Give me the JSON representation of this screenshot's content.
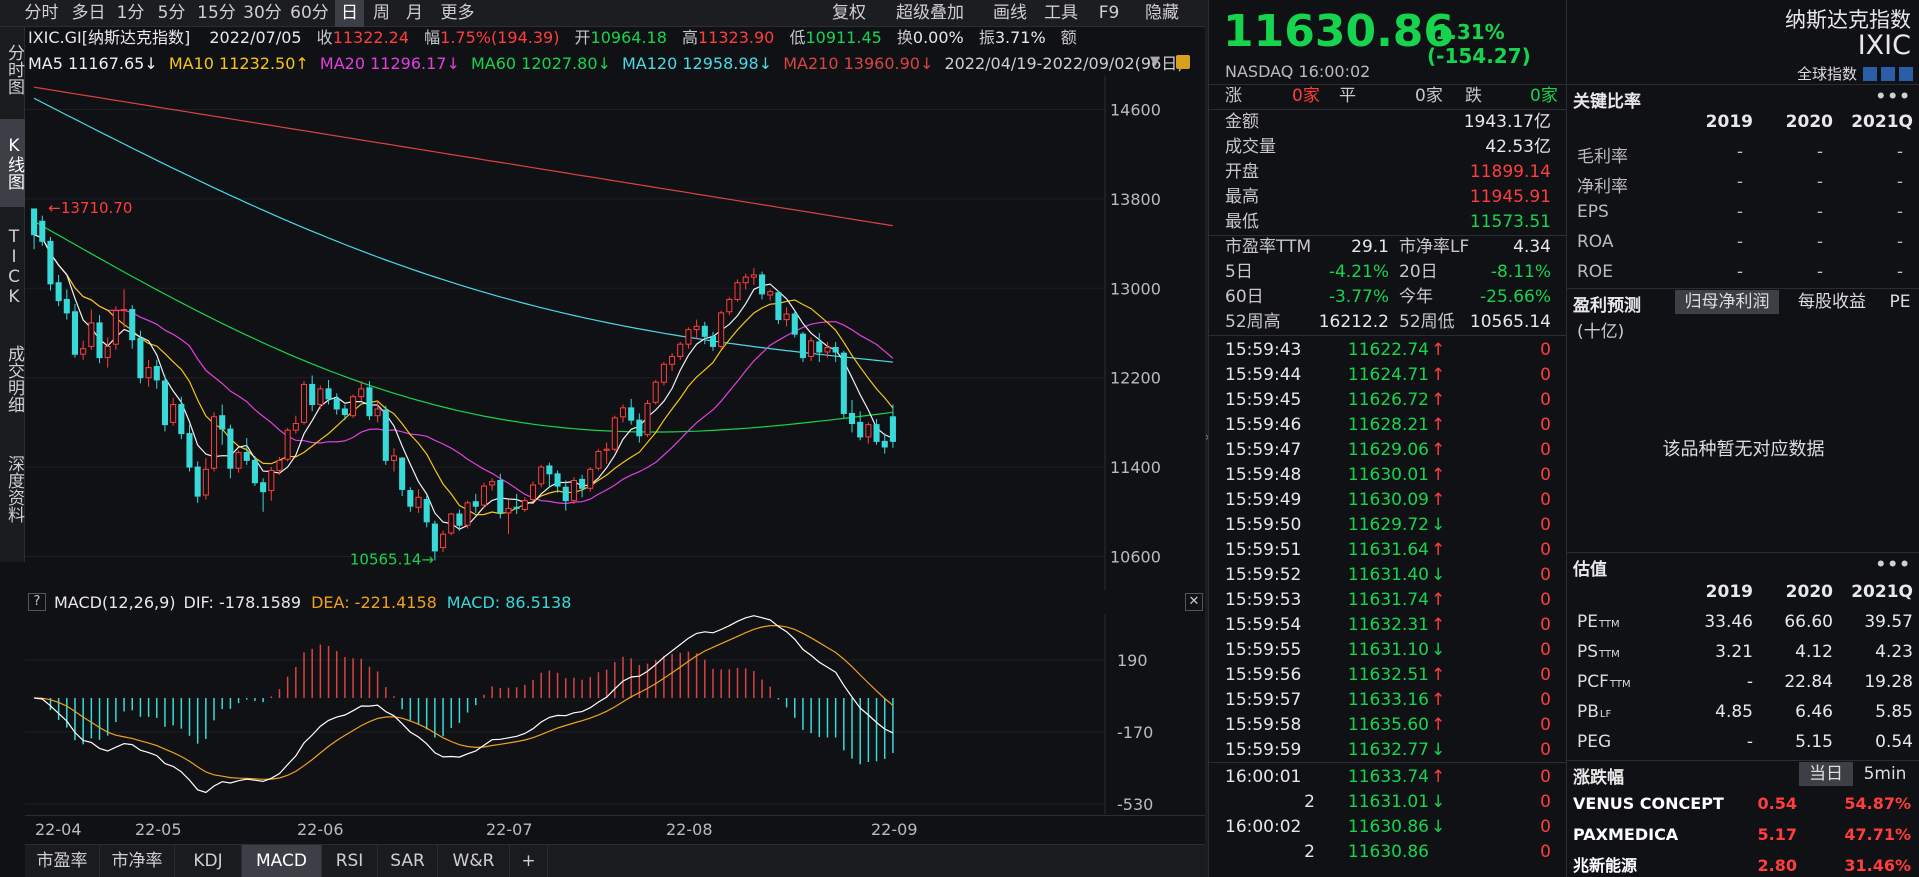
{
  "toolbar": {
    "periods": [
      "分时",
      "多日",
      "1分",
      "5分",
      "15分",
      "30分",
      "60分",
      "日",
      "周",
      "月",
      "更多"
    ],
    "active_period": "日",
    "right_tools": [
      "复权",
      "超级叠加",
      "画线",
      "工具",
      "F9",
      "隐藏"
    ]
  },
  "vertical_tabs": [
    "分时图",
    "K线图",
    "TICK",
    "成交明细",
    "深度资料"
  ],
  "active_vtab": "K线图",
  "info": {
    "code": "IXIC.GI[纳斯达克指数]",
    "date": "2022/07/05",
    "close_label": "收",
    "close": "11322.24",
    "amp_label": "幅",
    "amp": "1.75%(194.39)",
    "open_label": "开",
    "open": "10964.18",
    "high_label": "高",
    "high": "11323.90",
    "low_label": "低",
    "low": "10911.45",
    "turnover_label": "换",
    "turnover": "0.00%",
    "swing_label": "振",
    "swing": "3.71%",
    "amount_label": "额"
  },
  "ma_line": {
    "ma5": "MA5 11167.65↓",
    "ma10": "MA10 11232.50↑",
    "ma20": "MA20 11296.17↓",
    "ma60": "MA60 12027.80↓",
    "ma120": "MA120 12958.98↓",
    "ma210": "MA210 13960.90↓",
    "range": "2022/04/19-2022/09/02(96日)"
  },
  "price_axis": [
    "14600",
    "13800",
    "13000",
    "12200",
    "11400",
    "10600"
  ],
  "annotations": {
    "high_mark": "←13710.70",
    "low_mark": "10565.14→"
  },
  "macd": {
    "title": "MACD(12,26,9)",
    "dif": "DIF: -178.1589",
    "dea": "DEA: -221.4158",
    "macd": "MACD: 86.5138",
    "axis": [
      "190",
      "-170",
      "-530"
    ]
  },
  "date_axis": [
    "22-04",
    "22-05",
    "22-06",
    "22-07",
    "22-08",
    "22-09"
  ],
  "bottom_tabs": [
    "市盈率",
    "市净率",
    "KDJ",
    "MACD",
    "RSI",
    "SAR",
    "W&R",
    "+"
  ],
  "active_bottom_tab": "MACD",
  "colors": {
    "up": "#ff3d3d",
    "down": "#38d9d9",
    "ma5": "#f0f0f0",
    "ma10": "#f5c518",
    "ma20": "#e040e0",
    "ma60": "#17d44f",
    "ma120": "#4ad9e8",
    "ma210": "#d94343",
    "dif": "#ffffff",
    "dea": "#f0a020"
  },
  "chart_data": {
    "type": "candlestick",
    "title": "",
    "xlabel": "",
    "ylabel": "",
    "ylim": [
      10300,
      14900
    ],
    "candles": [
      {
        "o": 13710,
        "h": 13710,
        "c": 13480,
        "l": 13350
      },
      {
        "o": 13600,
        "h": 13650,
        "c": 13420,
        "l": 13380
      },
      {
        "o": 13420,
        "h": 13460,
        "c": 13040,
        "l": 12980
      },
      {
        "o": 13050,
        "h": 13120,
        "c": 12890,
        "l": 12840
      },
      {
        "o": 12900,
        "h": 12990,
        "c": 12780,
        "l": 12720
      },
      {
        "o": 12790,
        "h": 12860,
        "c": 12410,
        "l": 12380
      },
      {
        "o": 12410,
        "h": 12530,
        "c": 12460,
        "l": 12360
      },
      {
        "o": 12480,
        "h": 12810,
        "c": 12690,
        "l": 12450
      },
      {
        "o": 12690,
        "h": 12760,
        "c": 12380,
        "l": 12330
      },
      {
        "o": 12380,
        "h": 12560,
        "c": 12480,
        "l": 12290
      },
      {
        "o": 12500,
        "h": 12840,
        "c": 12800,
        "l": 12450
      },
      {
        "o": 12800,
        "h": 12990,
        "c": 12810,
        "l": 12650
      },
      {
        "o": 12810,
        "h": 12850,
        "c": 12540,
        "l": 12460
      },
      {
        "o": 12550,
        "h": 12620,
        "c": 12200,
        "l": 12150
      },
      {
        "o": 12200,
        "h": 12360,
        "c": 12290,
        "l": 12120
      },
      {
        "o": 12300,
        "h": 12360,
        "c": 12180,
        "l": 12100
      },
      {
        "o": 12170,
        "h": 12220,
        "c": 11780,
        "l": 11720
      },
      {
        "o": 11800,
        "h": 12020,
        "c": 11960,
        "l": 11770
      },
      {
        "o": 11960,
        "h": 12030,
        "c": 11700,
        "l": 11650
      },
      {
        "o": 11700,
        "h": 11780,
        "c": 11400,
        "l": 11360
      },
      {
        "o": 11400,
        "h": 11450,
        "c": 11140,
        "l": 11080
      },
      {
        "o": 11150,
        "h": 11480,
        "c": 11380,
        "l": 11110
      },
      {
        "o": 11390,
        "h": 11890,
        "c": 11850,
        "l": 11360
      },
      {
        "o": 11860,
        "h": 11960,
        "c": 11740,
        "l": 11600
      },
      {
        "o": 11740,
        "h": 11780,
        "c": 11390,
        "l": 11300
      },
      {
        "o": 11390,
        "h": 11550,
        "c": 11530,
        "l": 11350
      },
      {
        "o": 11530,
        "h": 11660,
        "c": 11460,
        "l": 11420
      },
      {
        "o": 11460,
        "h": 11500,
        "c": 11260,
        "l": 11230
      },
      {
        "o": 11260,
        "h": 11300,
        "c": 11180,
        "l": 11000
      },
      {
        "o": 11190,
        "h": 11400,
        "c": 11370,
        "l": 11100
      },
      {
        "o": 11370,
        "h": 11490,
        "c": 11460,
        "l": 11330
      },
      {
        "o": 11470,
        "h": 11750,
        "c": 11730,
        "l": 11450
      },
      {
        "o": 11730,
        "h": 11860,
        "c": 11790,
        "l": 11700
      },
      {
        "o": 11800,
        "h": 12170,
        "c": 12140,
        "l": 11780
      },
      {
        "o": 12140,
        "h": 12220,
        "c": 11960,
        "l": 11900
      },
      {
        "o": 11960,
        "h": 12130,
        "c": 12100,
        "l": 11920
      },
      {
        "o": 12100,
        "h": 12180,
        "c": 12010,
        "l": 11960
      },
      {
        "o": 12010,
        "h": 12060,
        "c": 11920,
        "l": 11870
      },
      {
        "o": 11920,
        "h": 11960,
        "c": 11870,
        "l": 11820
      },
      {
        "o": 11860,
        "h": 12050,
        "c": 12030,
        "l": 11840
      },
      {
        "o": 12030,
        "h": 12170,
        "c": 12100,
        "l": 11990
      },
      {
        "o": 12110,
        "h": 12170,
        "c": 11860,
        "l": 11820
      },
      {
        "o": 11860,
        "h": 11990,
        "c": 11920,
        "l": 11800
      },
      {
        "o": 11910,
        "h": 11950,
        "c": 11460,
        "l": 11420
      },
      {
        "o": 11460,
        "h": 11570,
        "c": 11500,
        "l": 11360
      },
      {
        "o": 11480,
        "h": 11490,
        "c": 11200,
        "l": 11140
      },
      {
        "o": 11190,
        "h": 11220,
        "c": 11050,
        "l": 11000
      },
      {
        "o": 11040,
        "h": 11200,
        "c": 11130,
        "l": 10990
      },
      {
        "o": 11110,
        "h": 11140,
        "c": 10910,
        "l": 10860
      },
      {
        "o": 10890,
        "h": 10920,
        "c": 10650,
        "l": 10565
      },
      {
        "o": 10680,
        "h": 10830,
        "c": 10800,
        "l": 10640
      },
      {
        "o": 10810,
        "h": 10990,
        "c": 10980,
        "l": 10790
      },
      {
        "o": 10980,
        "h": 11020,
        "c": 10880,
        "l": 10830
      },
      {
        "o": 10880,
        "h": 11100,
        "c": 11080,
        "l": 10850
      },
      {
        "o": 11090,
        "h": 11160,
        "c": 11050,
        "l": 10990
      },
      {
        "o": 11060,
        "h": 11260,
        "c": 11230,
        "l": 11030
      },
      {
        "o": 11240,
        "h": 11300,
        "c": 11270,
        "l": 11190
      },
      {
        "o": 11280,
        "h": 11340,
        "c": 10990,
        "l": 10940
      },
      {
        "o": 10990,
        "h": 11110,
        "c": 11030,
        "l": 10800
      },
      {
        "o": 11040,
        "h": 11160,
        "c": 11030,
        "l": 10980
      },
      {
        "o": 11020,
        "h": 11130,
        "c": 11100,
        "l": 11000
      },
      {
        "o": 11110,
        "h": 11270,
        "c": 11240,
        "l": 11090
      },
      {
        "o": 11250,
        "h": 11420,
        "c": 11400,
        "l": 11220
      },
      {
        "o": 11410,
        "h": 11440,
        "c": 11340,
        "l": 11220
      },
      {
        "o": 11340,
        "h": 11370,
        "c": 11230,
        "l": 11170
      },
      {
        "o": 11220,
        "h": 11280,
        "c": 11100,
        "l": 11010
      },
      {
        "o": 11100,
        "h": 11310,
        "c": 11280,
        "l": 11070
      },
      {
        "o": 11290,
        "h": 11330,
        "c": 11210,
        "l": 11130
      },
      {
        "o": 11210,
        "h": 11400,
        "c": 11380,
        "l": 11180
      },
      {
        "o": 11390,
        "h": 11560,
        "c": 11540,
        "l": 11370
      },
      {
        "o": 11550,
        "h": 11620,
        "c": 11560,
        "l": 11430
      },
      {
        "o": 11560,
        "h": 11860,
        "c": 11840,
        "l": 11540
      },
      {
        "o": 11850,
        "h": 11960,
        "c": 11930,
        "l": 11800
      },
      {
        "o": 11930,
        "h": 12010,
        "c": 11820,
        "l": 11780
      },
      {
        "o": 11820,
        "h": 11880,
        "c": 11680,
        "l": 11620
      },
      {
        "o": 11690,
        "h": 12000,
        "c": 11970,
        "l": 11670
      },
      {
        "o": 11980,
        "h": 12180,
        "c": 12160,
        "l": 11960
      },
      {
        "o": 12160,
        "h": 12340,
        "c": 12320,
        "l": 12130
      },
      {
        "o": 12320,
        "h": 12420,
        "c": 12390,
        "l": 12260
      },
      {
        "o": 12390,
        "h": 12520,
        "c": 12500,
        "l": 12360
      },
      {
        "o": 12500,
        "h": 12650,
        "c": 12630,
        "l": 12460
      },
      {
        "o": 12630,
        "h": 12720,
        "c": 12660,
        "l": 12550
      },
      {
        "o": 12660,
        "h": 12700,
        "c": 12570,
        "l": 12500
      },
      {
        "o": 12570,
        "h": 12610,
        "c": 12480,
        "l": 12440
      },
      {
        "o": 12480,
        "h": 12800,
        "c": 12780,
        "l": 12460
      },
      {
        "o": 12790,
        "h": 12920,
        "c": 12900,
        "l": 12760
      },
      {
        "o": 12900,
        "h": 13080,
        "c": 13050,
        "l": 12880
      },
      {
        "o": 13050,
        "h": 13130,
        "c": 13100,
        "l": 12990
      },
      {
        "o": 13100,
        "h": 13180,
        "c": 13120,
        "l": 13030
      },
      {
        "o": 13120,
        "h": 13150,
        "c": 12950,
        "l": 12900
      },
      {
        "o": 12940,
        "h": 12990,
        "c": 12970,
        "l": 12890
      },
      {
        "o": 12960,
        "h": 12980,
        "c": 12720,
        "l": 12680
      },
      {
        "o": 12720,
        "h": 12830,
        "c": 12770,
        "l": 12660
      },
      {
        "o": 12770,
        "h": 12800,
        "c": 12590,
        "l": 12560
      },
      {
        "o": 12590,
        "h": 12610,
        "c": 12380,
        "l": 12340
      },
      {
        "o": 12390,
        "h": 12560,
        "c": 12530,
        "l": 12350
      },
      {
        "o": 12520,
        "h": 12600,
        "c": 12430,
        "l": 12340
      },
      {
        "o": 12430,
        "h": 12520,
        "c": 12470,
        "l": 12380
      },
      {
        "o": 12470,
        "h": 12520,
        "c": 12430,
        "l": 12340
      },
      {
        "o": 12420,
        "h": 12440,
        "c": 11880,
        "l": 11840
      },
      {
        "o": 11880,
        "h": 12000,
        "c": 11790,
        "l": 11710
      },
      {
        "o": 11800,
        "h": 11900,
        "c": 11670,
        "l": 11640
      },
      {
        "o": 11670,
        "h": 11800,
        "c": 11780,
        "l": 11610
      },
      {
        "o": 11780,
        "h": 11830,
        "c": 11630,
        "l": 11600
      },
      {
        "o": 11630,
        "h": 11700,
        "c": 11580,
        "l": 11520
      },
      {
        "o": 11850,
        "h": 11960,
        "c": 11630,
        "l": 11573
      }
    ]
  },
  "quote": {
    "price": "11630.86",
    "change": "-1.31% (-154.27)",
    "name": "纳斯达克指数",
    "code": "IXIC",
    "exchange_time": "NASDAQ  16:00:02",
    "category": "全球指数",
    "up_label": "涨",
    "up": "0家",
    "flat_label": "平",
    "flat": "0家",
    "down_label": "跌",
    "down": "0家",
    "fields": [
      {
        "label": "金额",
        "value": "1943.17亿",
        "color": "white"
      },
      {
        "label": "成交量",
        "value": "42.53亿",
        "color": "white"
      },
      {
        "label": "开盘",
        "value": "11899.14",
        "color": "red"
      },
      {
        "label": "最高",
        "value": "11945.91",
        "color": "red"
      },
      {
        "label": "最低",
        "value": "11573.51",
        "color": "green"
      }
    ],
    "pe_label": "市盈率TTM",
    "pe": "29.1",
    "pb_label": "市净率LF",
    "pb": "4.34",
    "d5_label": "5日",
    "d5": "-4.21%",
    "d20_label": "20日",
    "d20": "-8.11%",
    "d60_label": "60日",
    "d60": "-3.77%",
    "ytd_label": "今年",
    "ytd": "-25.66%",
    "hi52_label": "52周高",
    "hi52": "16212.2",
    "lo52_label": "52周低",
    "lo52": "10565.14"
  },
  "ticks": [
    {
      "t": "15:59:43",
      "p": "11622.74",
      "d": "up",
      "v": "0"
    },
    {
      "t": "15:59:44",
      "p": "11624.71",
      "d": "up",
      "v": "0"
    },
    {
      "t": "15:59:45",
      "p": "11626.72",
      "d": "up",
      "v": "0"
    },
    {
      "t": "15:59:46",
      "p": "11628.21",
      "d": "up",
      "v": "0"
    },
    {
      "t": "15:59:47",
      "p": "11629.06",
      "d": "up",
      "v": "0"
    },
    {
      "t": "15:59:48",
      "p": "11630.01",
      "d": "up",
      "v": "0"
    },
    {
      "t": "15:59:49",
      "p": "11630.09",
      "d": "up",
      "v": "0"
    },
    {
      "t": "15:59:50",
      "p": "11629.72",
      "d": "down",
      "v": "0"
    },
    {
      "t": "15:59:51",
      "p": "11631.64",
      "d": "up",
      "v": "0"
    },
    {
      "t": "15:59:52",
      "p": "11631.40",
      "d": "down",
      "v": "0"
    },
    {
      "t": "15:59:53",
      "p": "11631.74",
      "d": "up",
      "v": "0"
    },
    {
      "t": "15:59:54",
      "p": "11632.31",
      "d": "up",
      "v": "0"
    },
    {
      "t": "15:59:55",
      "p": "11631.10",
      "d": "down",
      "v": "0"
    },
    {
      "t": "15:59:56",
      "p": "11632.51",
      "d": "up",
      "v": "0"
    },
    {
      "t": "15:59:57",
      "p": "11633.16",
      "d": "up",
      "v": "0"
    },
    {
      "t": "15:59:58",
      "p": "11635.60",
      "d": "up",
      "v": "0"
    },
    {
      "t": "15:59:59",
      "p": "11632.77",
      "d": "down",
      "v": "0"
    },
    {
      "t": "16:00:01",
      "p": "11633.74",
      "d": "up",
      "v": "0"
    },
    {
      "t": "2",
      "p": "11631.01",
      "d": "down",
      "v": "0"
    },
    {
      "t": "16:00:02",
      "p": "11630.86",
      "d": "down",
      "v": "0"
    },
    {
      "t": "2",
      "p": "11630.86",
      "d": "",
      "v": "0"
    }
  ],
  "ratios": {
    "title": "关键比率",
    "years": [
      "2019",
      "2020",
      "2021Q"
    ],
    "rows": [
      {
        "label": "毛利率",
        "vals": [
          "-",
          "-",
          "-"
        ]
      },
      {
        "label": "净利率",
        "vals": [
          "-",
          "-",
          "-"
        ]
      },
      {
        "label": "EPS",
        "vals": [
          "-",
          "-",
          "-"
        ]
      },
      {
        "label": "ROA",
        "vals": [
          "-",
          "-",
          "-"
        ]
      },
      {
        "label": "ROE",
        "vals": [
          "-",
          "-",
          "-"
        ]
      }
    ]
  },
  "forecast": {
    "title": "盈利预测",
    "tabs": [
      "归母净利润",
      "每股收益",
      "PE"
    ],
    "unit": "(十亿)",
    "empty": "该品种暂无对应数据"
  },
  "valuation": {
    "title": "估值",
    "years": [
      "2019",
      "2020",
      "2021Q"
    ],
    "rows": [
      {
        "label": "PE",
        "sup": "TTM",
        "vals": [
          "33.46",
          "66.60",
          "39.57"
        ]
      },
      {
        "label": "PS",
        "sup": "TTM",
        "vals": [
          "3.21",
          "4.12",
          "4.23"
        ]
      },
      {
        "label": "PCF",
        "sup": "TTM",
        "vals": [
          "-",
          "22.84",
          "19.28"
        ]
      },
      {
        "label": "PB",
        "sup": "LF",
        "vals": [
          "4.85",
          "6.46",
          "5.85"
        ]
      },
      {
        "label": "PEG",
        "sup": "",
        "vals": [
          "-",
          "5.15",
          "0.54"
        ]
      }
    ]
  },
  "movers": {
    "title": "涨跌幅",
    "tabs": [
      "当日",
      "5min"
    ],
    "rows": [
      {
        "name": "VENUS CONCEPT",
        "price": "0.54",
        "pct": "54.87%"
      },
      {
        "name": "PAXMEDICA",
        "price": "5.17",
        "pct": "47.71%"
      },
      {
        "name": "兆新能源",
        "price": "2.80",
        "pct": "31.46%"
      }
    ]
  }
}
